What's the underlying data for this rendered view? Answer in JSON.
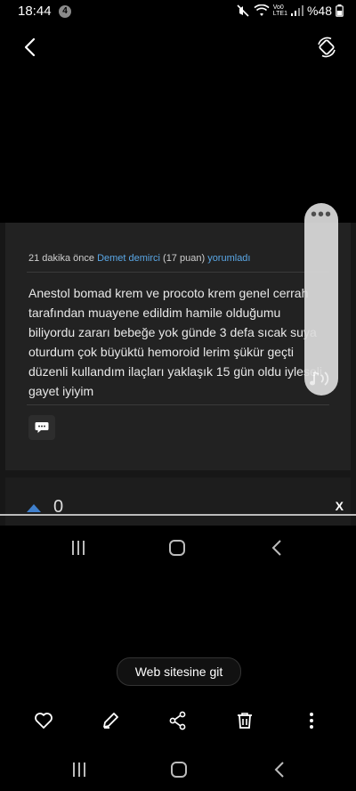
{
  "status": {
    "time": "18:44",
    "notif_count": "4",
    "battery": "%48",
    "volte_top": "Vo0",
    "volte_bottom": "LTE1"
  },
  "comment": {
    "time_ago": "21 dakika önce",
    "author": "Demet demirci",
    "points": "(17 puan)",
    "action": "yorumladı",
    "text": "Anestol bomad krem  ve procoto krem genel cerrah tarafından muayene edildim hamile olduğumu biliyordu zararı bebeğe yok günde 3 defa sıcak suya oturdum çok büyüktü hemoroid lerim şükür geçti düzenli kullandım ilaçları yaklaşık 15 gün oldu iyleseli gayet iyiyim"
  },
  "vote": {
    "count": "0"
  },
  "close_label": "X",
  "float_panel": {
    "menu": "•••"
  },
  "web_button": "Web sitesine git",
  "icons": {
    "back": "back-icon",
    "rotate": "rotate-icon",
    "like": "heart-icon",
    "edit": "pencil-icon",
    "share": "share-icon",
    "delete": "trash-icon",
    "more": "more-vert-icon"
  },
  "colors": {
    "link": "#5aa7e6",
    "vote": "#3f7fcc",
    "background": "#000000"
  }
}
